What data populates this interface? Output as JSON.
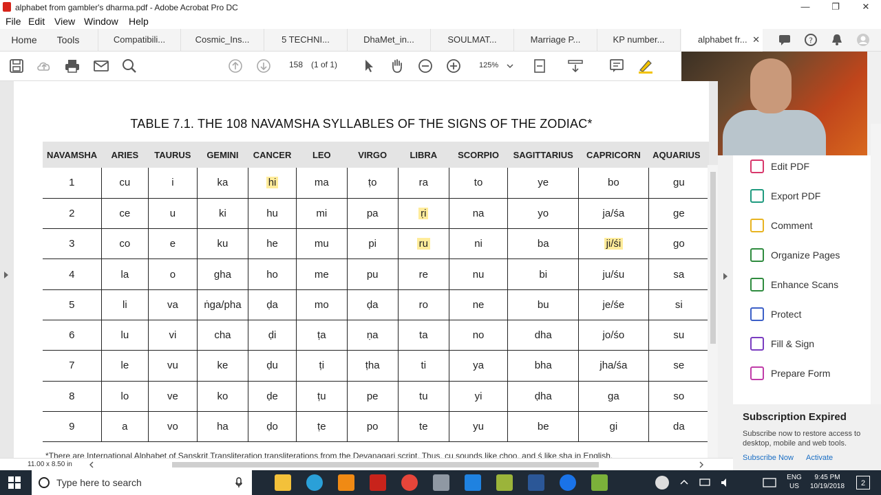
{
  "window": {
    "title": "alphabet from gambler's dharma.pdf - Adobe Acrobat Pro DC",
    "minimize": "—",
    "maximize": "❐",
    "close": "✕"
  },
  "menu": [
    "File",
    "Edit",
    "View",
    "Window",
    "Help"
  ],
  "tabs": {
    "home": "Home",
    "tools": "Tools",
    "docs": [
      "Compatibili...",
      "Cosmic_Ins...",
      "5 TECHNI...",
      "DhaMet_in...",
      "SOULMAT...",
      "Marriage P...",
      "KP number..."
    ],
    "active": "alphabet fr...",
    "close": "✕"
  },
  "toolbar": {
    "page_number": "158",
    "page_of": "(1 of 1)",
    "zoom": "125%"
  },
  "document": {
    "table_title": "TABLE 7.1. THE 108 NAVAMSHA SYLLABLES OF THE SIGNS OF THE ZODIAC*",
    "headers": [
      "NAVAMSHA",
      "ARIES",
      "TAURUS",
      "GEMINI",
      "CANCER",
      "LEO",
      "VIRGO",
      "LIBRA",
      "SCORPIO",
      "SAGITTARIUS",
      "CAPRICORN",
      "AQUARIUS"
    ],
    "rows": [
      [
        "1",
        "cu",
        "i",
        "ka",
        "hi",
        "ma",
        "ṭo",
        "ra",
        "to",
        "ye",
        "bo",
        "gu"
      ],
      [
        "2",
        "ce",
        "u",
        "ki",
        "hu",
        "mi",
        "pa",
        "ṛi",
        "na",
        "yo",
        "ja/śa",
        "ge"
      ],
      [
        "3",
        "co",
        "e",
        "ku",
        "he",
        "mu",
        "pi",
        "ru",
        "ni",
        "ba",
        "ji/śi",
        "go"
      ],
      [
        "4",
        "la",
        "o",
        "gha",
        "ho",
        "me",
        "pu",
        "re",
        "nu",
        "bi",
        "ju/śu",
        "sa"
      ],
      [
        "5",
        "li",
        "va",
        "ṅga/pha",
        "ḍa",
        "mo",
        "ḍa",
        "ro",
        "ne",
        "bu",
        "je/śe",
        "si"
      ],
      [
        "6",
        "lu",
        "vi",
        "cha",
        "ḍi",
        "ṭa",
        "ṇa",
        "ta",
        "no",
        "dha",
        "jo/śo",
        "su"
      ],
      [
        "7",
        "le",
        "vu",
        "ke",
        "ḍu",
        "ṭi",
        "ṭha",
        "ti",
        "ya",
        "bha",
        "jha/śa",
        "se"
      ],
      [
        "8",
        "lo",
        "ve",
        "ko",
        "ḍe",
        "ṭu",
        "pe",
        "tu",
        "yi",
        "ḍha",
        "ga",
        "so"
      ],
      [
        "9",
        "a",
        "vo",
        "ha",
        "ḍo",
        "ṭe",
        "po",
        "te",
        "yu",
        "be",
        "gi",
        "da"
      ]
    ],
    "highlighted": [
      [
        0,
        4
      ],
      [
        1,
        7
      ],
      [
        2,
        7
      ],
      [
        2,
        10
      ]
    ],
    "footnote": "*There are International Alphabet of Sanskrit Transliteration transliterations from the Devanagari script. Thus, cu sounds like choo, and ś like sha in English."
  },
  "right_panel": {
    "items": [
      "Edit PDF",
      "Export PDF",
      "Comment",
      "Organize Pages",
      "Enhance Scans",
      "Protect",
      "Fill & Sign",
      "Prepare Form"
    ],
    "icon_colors": [
      "#d8376b",
      "#1e9a7e",
      "#e8b320",
      "#2e8b3e",
      "#2e8b3e",
      "#3b5fc7",
      "#7a3cc0",
      "#c03ca8"
    ]
  },
  "subscription": {
    "title": "Subscription Expired",
    "text": "Subscribe now to restore access to desktop, mobile and web tools.",
    "subscribe": "Subscribe Now",
    "activate": "Activate"
  },
  "status": {
    "page_size": "11.00 x 8.50 in"
  },
  "taskbar": {
    "search_placeholder": "Type here to search",
    "lang_line1": "ENG",
    "lang_line2": "US",
    "time": "9:45 PM",
    "date": "10/19/2018",
    "notifications": "2"
  }
}
